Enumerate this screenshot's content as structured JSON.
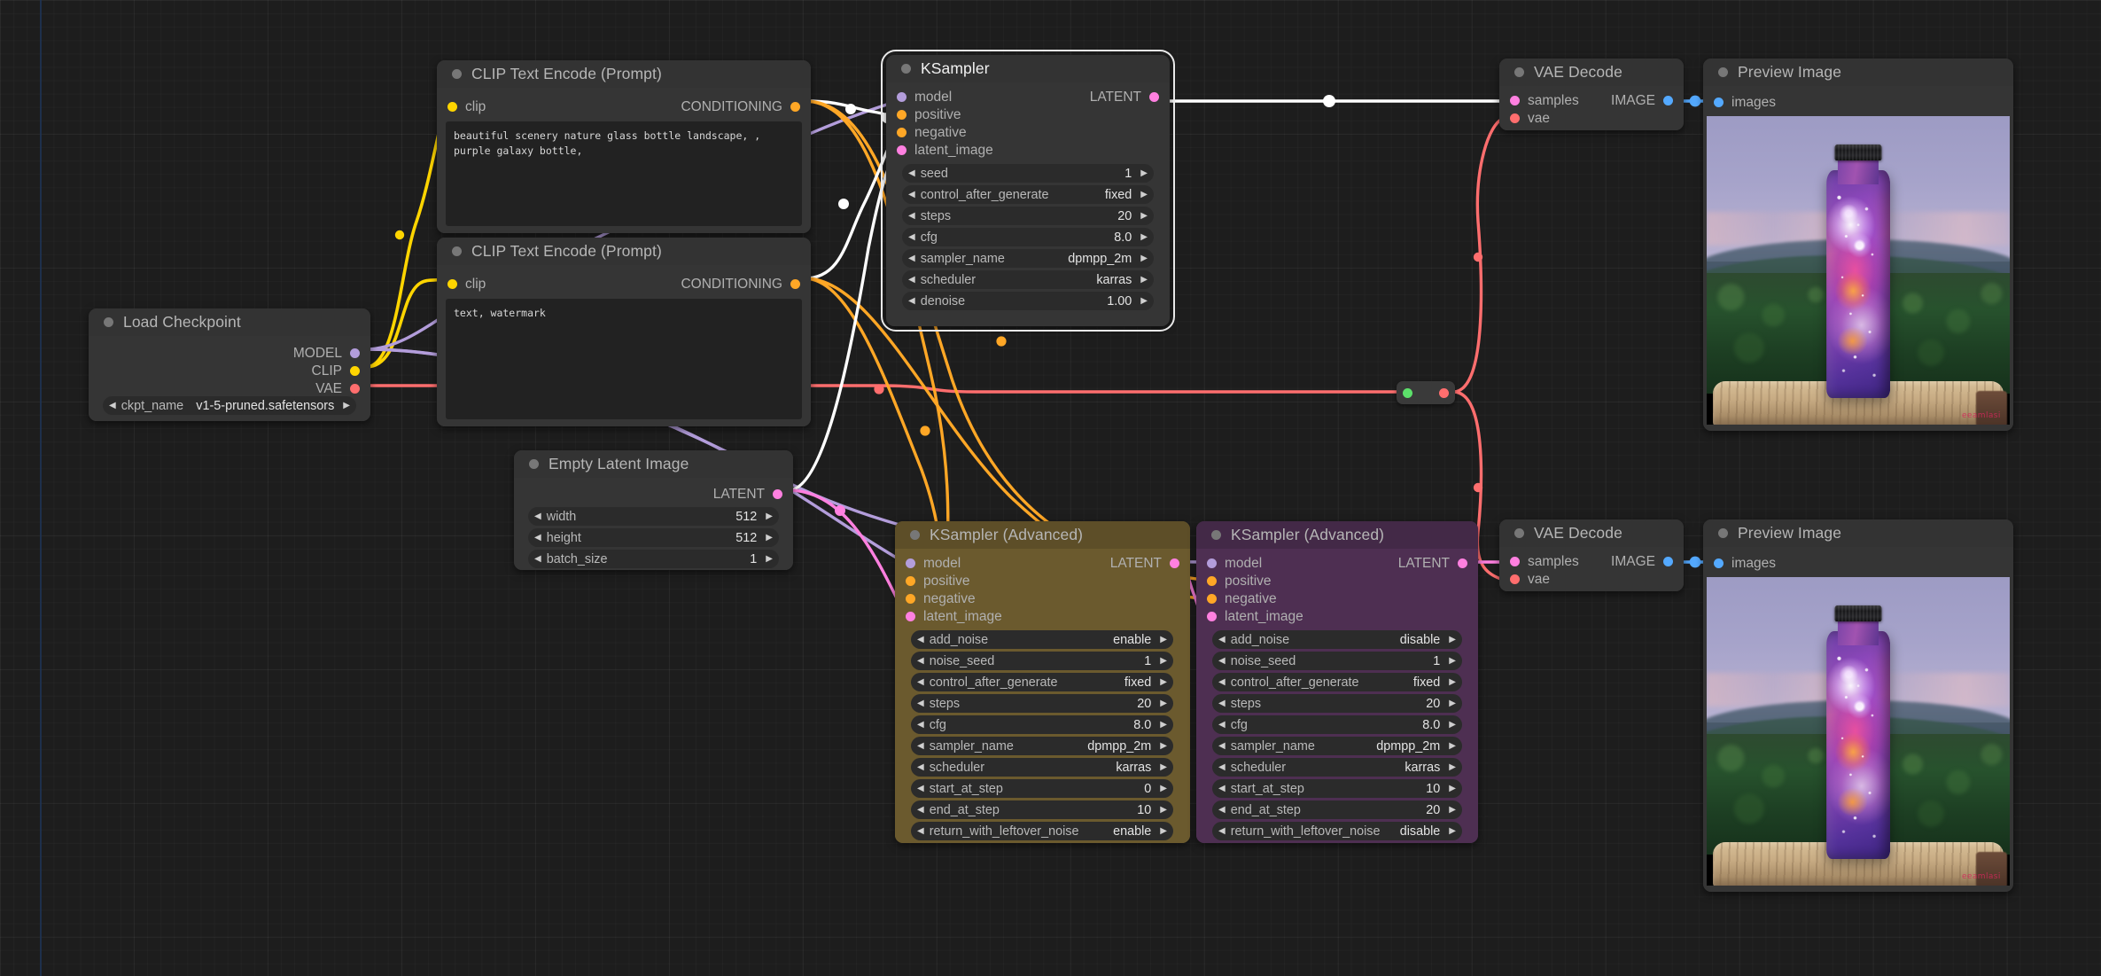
{
  "app": "ComfyUI node graph canvas",
  "canvas": {
    "background_color": "#1d1d1d",
    "grid_color": "#2a2a2a",
    "axis_color": "#1d3354"
  },
  "wire_colors": {
    "model": "#b39ddb",
    "clip": "#ffd500",
    "vae": "#ff6e6e",
    "conditioning": "#ffa726",
    "latent": "#ff80e0",
    "image": "#54a9ff",
    "selected": "#ffffff"
  },
  "nodes": {
    "clip_positive": {
      "title": "CLIP Text Encode (Prompt)",
      "inputs": [
        {
          "label": "clip",
          "type": "clip"
        }
      ],
      "outputs": [
        {
          "label": "CONDITIONING",
          "type": "conditioning"
        }
      ],
      "text": "beautiful scenery nature glass bottle landscape, , purple galaxy bottle,"
    },
    "clip_negative": {
      "title": "CLIP Text Encode (Prompt)",
      "inputs": [
        {
          "label": "clip",
          "type": "clip"
        }
      ],
      "outputs": [
        {
          "label": "CONDITIONING",
          "type": "conditioning"
        }
      ],
      "text": "text, watermark"
    },
    "load_checkpoint": {
      "title": "Load Checkpoint",
      "outputs": [
        {
          "label": "MODEL",
          "type": "model"
        },
        {
          "label": "CLIP",
          "type": "clip"
        },
        {
          "label": "VAE",
          "type": "vae"
        }
      ],
      "widgets": [
        {
          "name": "ckpt_name",
          "value": "v1-5-pruned.safetensors"
        }
      ]
    },
    "ksampler": {
      "title": "KSampler",
      "selected": true,
      "inputs": [
        {
          "label": "model",
          "type": "model"
        },
        {
          "label": "positive",
          "type": "conditioning"
        },
        {
          "label": "negative",
          "type": "conditioning"
        },
        {
          "label": "latent_image",
          "type": "latent"
        }
      ],
      "outputs": [
        {
          "label": "LATENT",
          "type": "latent"
        }
      ],
      "widgets": [
        {
          "name": "seed",
          "value": "1"
        },
        {
          "name": "control_after_generate",
          "value": "fixed"
        },
        {
          "name": "steps",
          "value": "20"
        },
        {
          "name": "cfg",
          "value": "8.0"
        },
        {
          "name": "sampler_name",
          "value": "dpmpp_2m"
        },
        {
          "name": "scheduler",
          "value": "karras"
        },
        {
          "name": "denoise",
          "value": "1.00"
        }
      ]
    },
    "empty_latent": {
      "title": "Empty Latent Image",
      "outputs": [
        {
          "label": "LATENT",
          "type": "latent"
        }
      ],
      "widgets": [
        {
          "name": "width",
          "value": "512"
        },
        {
          "name": "height",
          "value": "512"
        },
        {
          "name": "batch_size",
          "value": "1"
        }
      ]
    },
    "ksampler_adv_1": {
      "title": "KSampler (Advanced)",
      "color": "#6b5a2e",
      "inputs": [
        {
          "label": "model",
          "type": "model"
        },
        {
          "label": "positive",
          "type": "conditioning"
        },
        {
          "label": "negative",
          "type": "conditioning"
        },
        {
          "label": "latent_image",
          "type": "latent"
        }
      ],
      "outputs": [
        {
          "label": "LATENT",
          "type": "latent"
        }
      ],
      "widgets": [
        {
          "name": "add_noise",
          "value": "enable"
        },
        {
          "name": "noise_seed",
          "value": "1"
        },
        {
          "name": "control_after_generate",
          "value": "fixed"
        },
        {
          "name": "steps",
          "value": "20"
        },
        {
          "name": "cfg",
          "value": "8.0"
        },
        {
          "name": "sampler_name",
          "value": "dpmpp_2m"
        },
        {
          "name": "scheduler",
          "value": "karras"
        },
        {
          "name": "start_at_step",
          "value": "0"
        },
        {
          "name": "end_at_step",
          "value": "10"
        },
        {
          "name": "return_with_leftover_noise",
          "value": "enable"
        }
      ]
    },
    "ksampler_adv_2": {
      "title": "KSampler (Advanced)",
      "color": "#4e2f52",
      "inputs": [
        {
          "label": "model",
          "type": "model"
        },
        {
          "label": "positive",
          "type": "conditioning"
        },
        {
          "label": "negative",
          "type": "conditioning"
        },
        {
          "label": "latent_image",
          "type": "latent"
        }
      ],
      "outputs": [
        {
          "label": "LATENT",
          "type": "latent"
        }
      ],
      "widgets": [
        {
          "name": "add_noise",
          "value": "disable"
        },
        {
          "name": "noise_seed",
          "value": "1"
        },
        {
          "name": "control_after_generate",
          "value": "fixed"
        },
        {
          "name": "steps",
          "value": "20"
        },
        {
          "name": "cfg",
          "value": "8.0"
        },
        {
          "name": "sampler_name",
          "value": "dpmpp_2m"
        },
        {
          "name": "scheduler",
          "value": "karras"
        },
        {
          "name": "start_at_step",
          "value": "10"
        },
        {
          "name": "end_at_step",
          "value": "20"
        },
        {
          "name": "return_with_leftover_noise",
          "value": "disable"
        }
      ]
    },
    "vae_decode_top": {
      "title": "VAE Decode",
      "inputs": [
        {
          "label": "samples",
          "type": "latent"
        },
        {
          "label": "vae",
          "type": "vae"
        }
      ],
      "outputs": [
        {
          "label": "IMAGE",
          "type": "image"
        }
      ]
    },
    "vae_decode_bottom": {
      "title": "VAE Decode",
      "inputs": [
        {
          "label": "samples",
          "type": "latent"
        },
        {
          "label": "vae",
          "type": "vae"
        }
      ],
      "outputs": [
        {
          "label": "IMAGE",
          "type": "image"
        }
      ]
    },
    "preview_top": {
      "title": "Preview Image",
      "inputs": [
        {
          "label": "images",
          "type": "image"
        }
      ],
      "image_caption": "galaxy patterned water bottle on a wooden stump with forested mountains behind",
      "watermark": "eeamlasi"
    },
    "preview_bottom": {
      "title": "Preview Image",
      "inputs": [
        {
          "label": "images",
          "type": "image"
        }
      ],
      "image_caption": "galaxy patterned water bottle on a wooden stump with forested mountains behind",
      "watermark": "eeamlasi"
    },
    "reroute_vae": {
      "title": "Reroute",
      "input_dot_color": "#5ce06a",
      "output_dot_color": "#ff6e6e"
    }
  }
}
